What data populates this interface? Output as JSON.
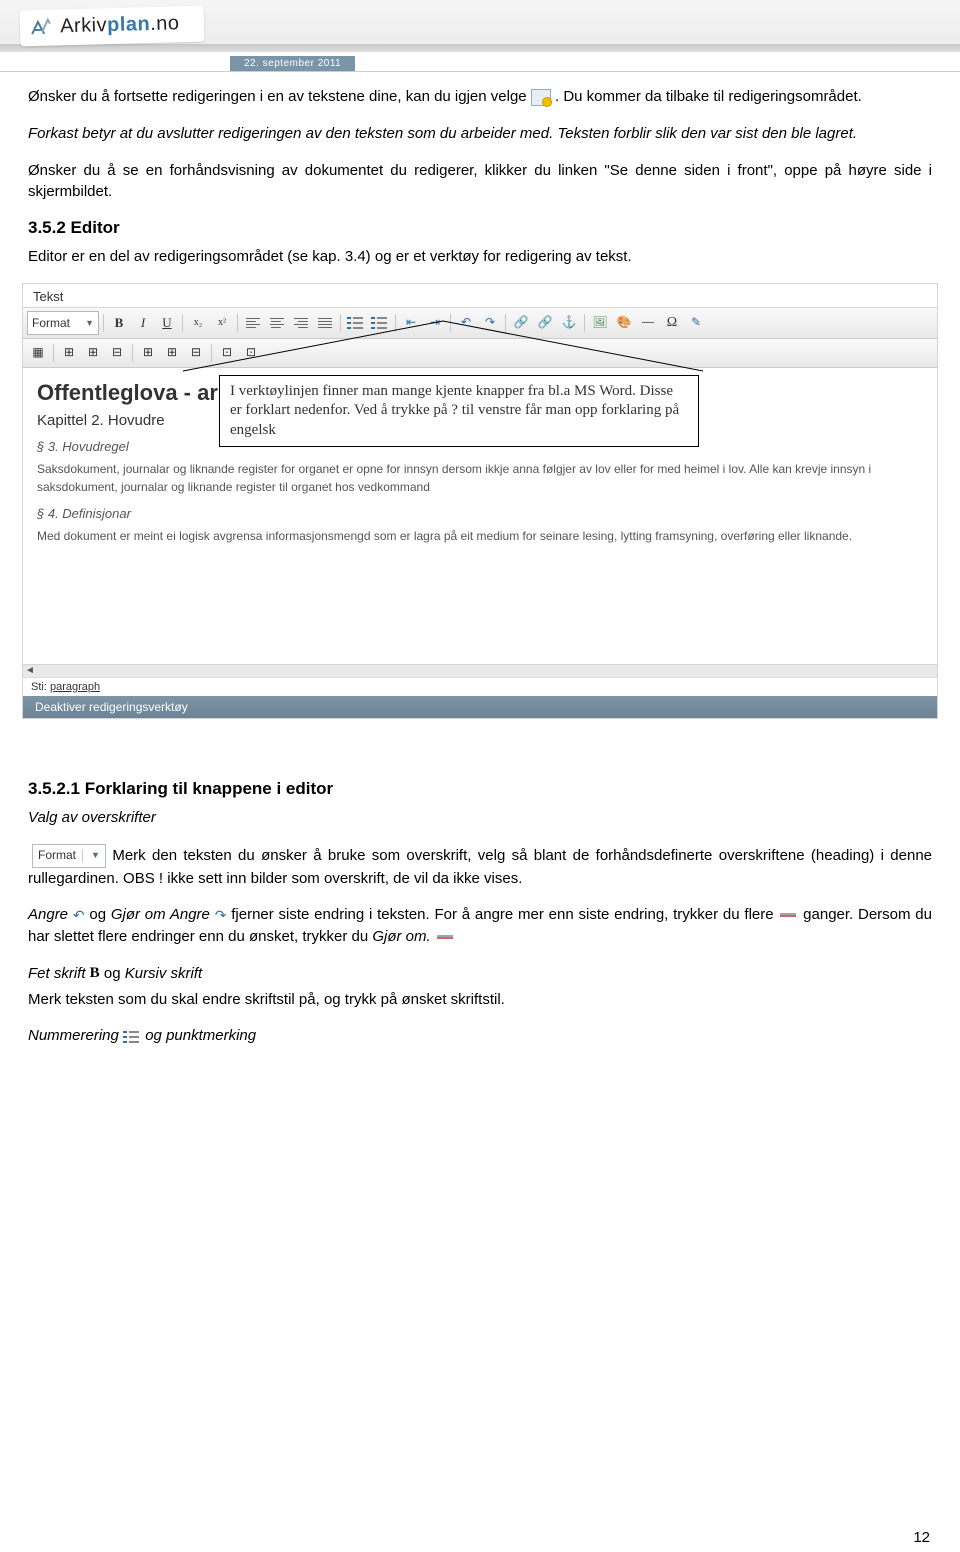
{
  "header": {
    "logo_text_1": "Arkiv",
    "logo_text_2": "plan",
    "logo_text_3": ".no",
    "date": "22. september 2011"
  },
  "p1a": "Ønsker du å fortsette redigeringen i en av tekstene dine, kan du igjen velge ",
  "p1b": ". Du kommer da tilbake til redigeringsområdet.",
  "p2": "Forkast betyr at du avslutter redigeringen av den teksten som du arbeider med. Teksten forblir slik den var sist den ble lagret.",
  "p3": "Ønsker du å se en forhåndsvisning av dokumentet du redigerer, klikker du linken \"Se denne siden i front\", oppe på høyre side i skjermbildet.",
  "h352": "3.5.2 Editor",
  "p4": "Editor er en del av redigeringsområdet (se kap. 3.4) og er et verktøy for redigering av tekst.",
  "editor": {
    "tab": "Tekst",
    "format_label": "Format",
    "h1": "Offentleglova - arki",
    "h3": "Kapittel 2. Hovudre",
    "s3": "§ 3. Hovudregel",
    "s3_text": "Saksdokument, journalar og liknande register for organet er opne for innsyn dersom ikkje anna følgjer av lov eller for med heimel i lov. Alle kan krevje innsyn i saksdokument, journalar og liknande register til organet hos vedkommand",
    "s4": "§ 4. Definisjonar",
    "s4_text": "Med dokument er meint ei logisk avgrensa informasjonsmengd som er lagra på eit medium for seinare lesing, lytting framsyning, overføring eller liknande.",
    "sti_label": "Sti:",
    "sti_path": "paragraph",
    "deactivate": "Deaktiver redigeringsverktøy"
  },
  "annotation": "I verktøylinjen finner man mange kjente knapper fra bl.a MS Word. Disse er forklart nedenfor. Ved å trykke på ? til venstre får man opp forklaring på engelsk",
  "h3521": "3.5.2.1 Forklaring til knappene i editor",
  "sub1": "Valg av overskrifter",
  "format_dd": "Format",
  "p5": " Merk den teksten du ønsker å bruke som overskrift, velg så blant de forhåndsdefinerte overskriftene (heading) i denne rullegardinen. OBS ! ikke sett inn bilder som overskrift, de vil da ikke vises.",
  "p6a_i": "Angre ",
  "p6a": " og ",
  "p6a2_i": "Gjør om Angre ",
  "p6b": " fjerner siste endring i teksten. For å angre mer enn siste endring, trykker du flere ",
  "p6c": "ganger. Dersom du har slettet flere endringer enn du ønsket, trykker du ",
  "p6c_i": "Gjør om. ",
  "p7a_i": "Fet skrift ",
  "p7a": "og ",
  "p7a2_i": "Kursiv skrift",
  "p7b": "Merk teksten som du skal endre skriftstil på, og trykk på ønsket skriftstil.",
  "p8a_i": "Nummerering ",
  "p8b": " og ",
  "p8b_i": "punktmerking",
  "pgnum": "12"
}
